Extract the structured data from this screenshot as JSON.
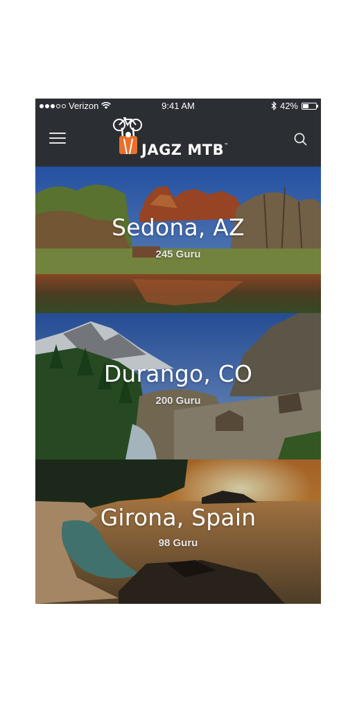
{
  "status_bar": {
    "carrier": "Verizon",
    "time": "9:41 AM",
    "battery": "42%",
    "battery_level": 0.42,
    "signal_bars_filled": 3,
    "signal_bars_total": 5
  },
  "header": {
    "logo_text": "JAGZ MTB",
    "logo_trademark": "™",
    "menu_icon": "hamburger-menu-icon",
    "search_icon": "search-icon",
    "background_color": "#2b2e33",
    "logo_accent_color": "#e8702a"
  },
  "destinations": [
    {
      "name": "Sedona, AZ",
      "count": "245 Guru"
    },
    {
      "name": "Durango, CO",
      "count": "200 Guru"
    },
    {
      "name": "Girona, Spain",
      "count": "98 Guru"
    }
  ]
}
